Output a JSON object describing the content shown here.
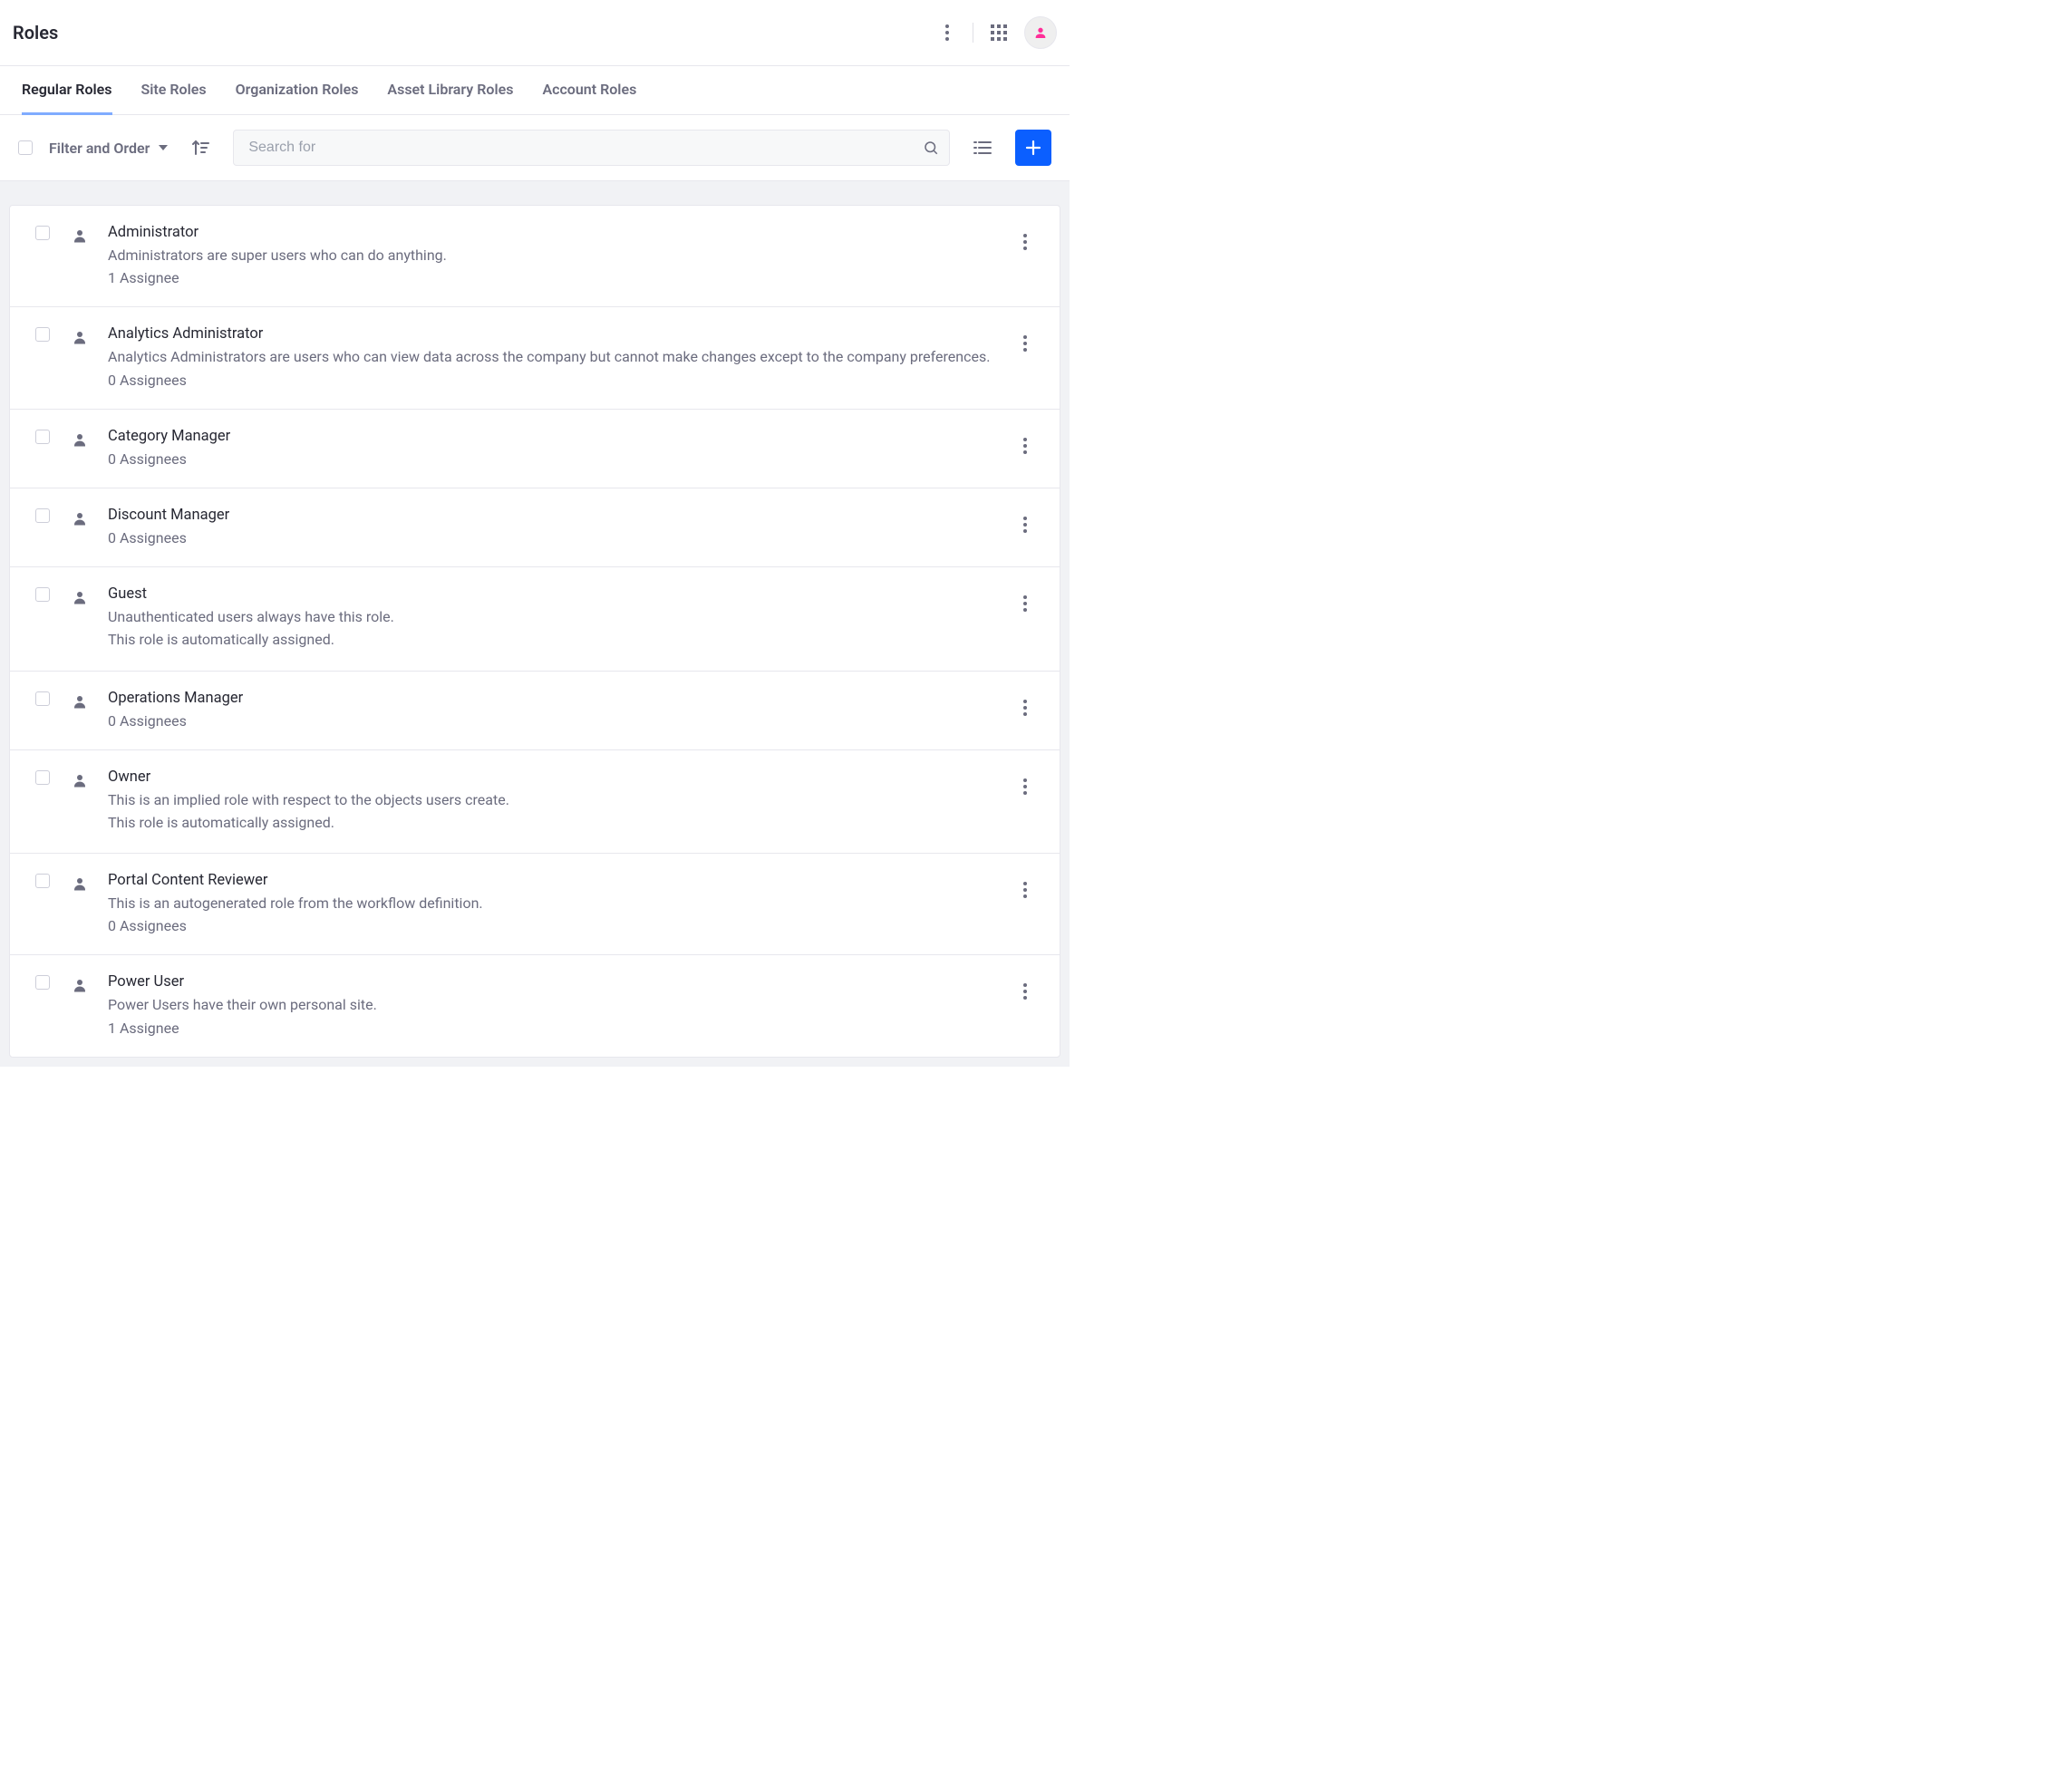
{
  "header": {
    "title": "Roles"
  },
  "tabs": [
    {
      "label": "Regular Roles",
      "active": true
    },
    {
      "label": "Site Roles",
      "active": false
    },
    {
      "label": "Organization Roles",
      "active": false
    },
    {
      "label": "Asset Library Roles",
      "active": false
    },
    {
      "label": "Account Roles",
      "active": false
    }
  ],
  "toolbar": {
    "filter_label": "Filter and Order",
    "search_placeholder": "Search for"
  },
  "roles": [
    {
      "name": "Administrator",
      "description": "Administrators are super users who can do anything.",
      "extra": "",
      "assignees": "1 Assignee"
    },
    {
      "name": "Analytics Administrator",
      "description": "Analytics Administrators are users who can view data across the company but cannot make changes except to the company preferences.",
      "extra": "",
      "assignees": "0 Assignees"
    },
    {
      "name": "Category Manager",
      "description": "",
      "extra": "",
      "assignees": "0 Assignees"
    },
    {
      "name": "Discount Manager",
      "description": "",
      "extra": "",
      "assignees": "0 Assignees"
    },
    {
      "name": "Guest",
      "description": "Unauthenticated users always have this role.",
      "extra": "This role is automatically assigned.",
      "assignees": ""
    },
    {
      "name": "Operations Manager",
      "description": "",
      "extra": "",
      "assignees": "0 Assignees"
    },
    {
      "name": "Owner",
      "description": "This is an implied role with respect to the objects users create.",
      "extra": "This role is automatically assigned.",
      "assignees": ""
    },
    {
      "name": "Portal Content Reviewer",
      "description": "This is an autogenerated role from the workflow definition.",
      "extra": "",
      "assignees": "0 Assignees"
    },
    {
      "name": "Power User",
      "description": "Power Users have their own personal site.",
      "extra": "",
      "assignees": "1 Assignee"
    }
  ]
}
